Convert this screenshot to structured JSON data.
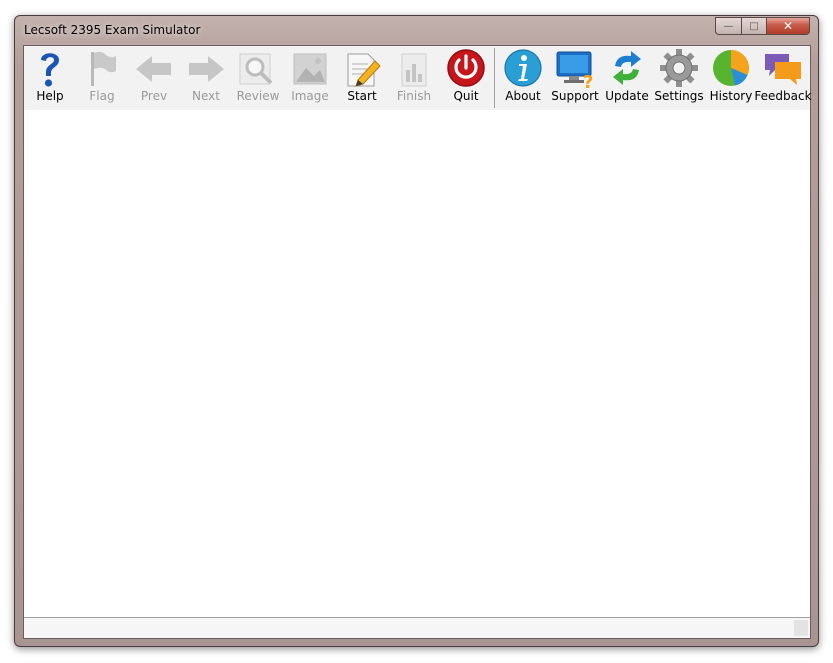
{
  "window": {
    "title": "Lecsoft 2395 Exam Simulator",
    "controls": {
      "minimize": "—",
      "maximize": "□",
      "close": "✕"
    }
  },
  "toolbar": {
    "items": [
      {
        "id": "help",
        "label": "Help",
        "icon": "help-icon",
        "enabled": true
      },
      {
        "id": "flag",
        "label": "Flag",
        "icon": "flag-icon",
        "enabled": false
      },
      {
        "id": "prev",
        "label": "Prev",
        "icon": "arrow-left-icon",
        "enabled": false
      },
      {
        "id": "next",
        "label": "Next",
        "icon": "arrow-right-icon",
        "enabled": false
      },
      {
        "id": "review",
        "label": "Review",
        "icon": "magnifier-icon",
        "enabled": false
      },
      {
        "id": "image",
        "label": "Image",
        "icon": "image-icon",
        "enabled": false
      },
      {
        "id": "start",
        "label": "Start",
        "icon": "pencil-paper-icon",
        "enabled": true
      },
      {
        "id": "finish",
        "label": "Finish",
        "icon": "finish-icon",
        "enabled": false
      },
      {
        "id": "quit",
        "label": "Quit",
        "icon": "power-icon",
        "enabled": true
      },
      {
        "id": "about",
        "label": "About",
        "icon": "info-icon",
        "enabled": true
      },
      {
        "id": "support",
        "label": "Support",
        "icon": "monitor-question-icon",
        "enabled": true
      },
      {
        "id": "update",
        "label": "Update",
        "icon": "refresh-arrows-icon",
        "enabled": true
      },
      {
        "id": "settings",
        "label": "Settings",
        "icon": "gear-icon",
        "enabled": true
      },
      {
        "id": "history",
        "label": "History",
        "icon": "pie-chart-icon",
        "enabled": true
      },
      {
        "id": "feedback",
        "label": "Feedback",
        "icon": "speech-bubbles-icon",
        "enabled": true
      }
    ]
  },
  "status": {
    "text": ""
  },
  "colors": {
    "frame": "#b39e99",
    "close_button": "#c75a48",
    "toolbar_bg": "#f2f2f2",
    "disabled_text": "#9a9a9a"
  }
}
